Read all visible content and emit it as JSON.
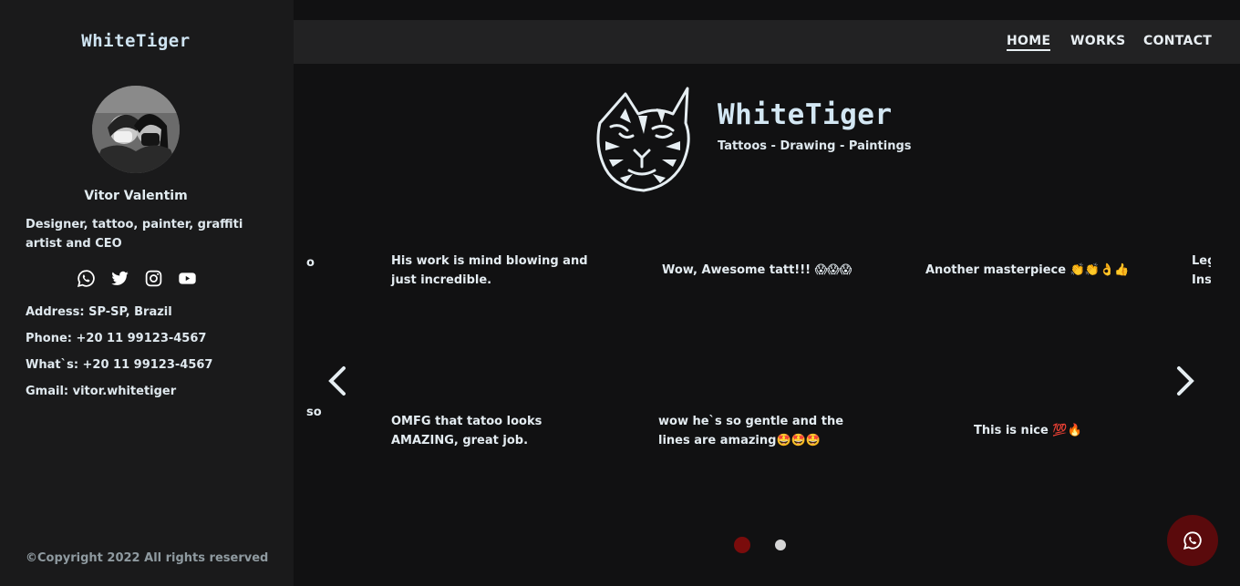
{
  "sidebar": {
    "brand": "WhiteTiger",
    "profile": {
      "name": "Vitor Valentim",
      "bio": "Designer, tattoo, painter, graffiti artist and CEO"
    },
    "socials": [
      "whatsapp-icon",
      "twitter-icon",
      "instagram-icon",
      "youtube-icon"
    ],
    "contact": {
      "address": "Address: SP-SP, Brazil",
      "phone": "Phone: +20 11 99123-4567",
      "whatsapp": "What`s: +20 11 99123-4567",
      "gmail": "Gmail: vitor.whitetiger"
    },
    "copyright": "©Copyright 2022 All rights reserved"
  },
  "nav": {
    "items": [
      {
        "label": "HOME",
        "active": true
      },
      {
        "label": "WORKS",
        "active": false
      },
      {
        "label": "CONTACT",
        "active": false
      }
    ]
  },
  "hero": {
    "title": "WhiteTiger",
    "subtitle": "Tattoos - Drawing - Paintings"
  },
  "testimonials": {
    "row1": [
      {
        "text": "o"
      },
      {
        "text": "His work is mind blowing and just incredible."
      },
      {
        "text": "Wow, Awesome tatt!!! 😱😱😱"
      },
      {
        "text": "Another masterpiece 👏👏👌👍"
      },
      {
        "text": "Leg Ins"
      }
    ],
    "row2": [
      {
        "text": "so"
      },
      {
        "text": "OMFG that tatoo looks AMAZING, great job."
      },
      {
        "text": "wow he`s so gentle and the lines are amazing🤩🤩🤩"
      },
      {
        "text": "This is nice 💯🔥"
      }
    ]
  },
  "carousel": {
    "prev": "chevron-left-icon",
    "next": "chevron-right-icon",
    "page_count": 2,
    "active_page": 1
  },
  "colors": {
    "background": "#111112",
    "sidebar": "#1a1a1b",
    "nav": "#222223",
    "active_dot": "#7a0c0c",
    "inactive_dot": "#d6d6d6",
    "fab": "#5a0a0c"
  }
}
